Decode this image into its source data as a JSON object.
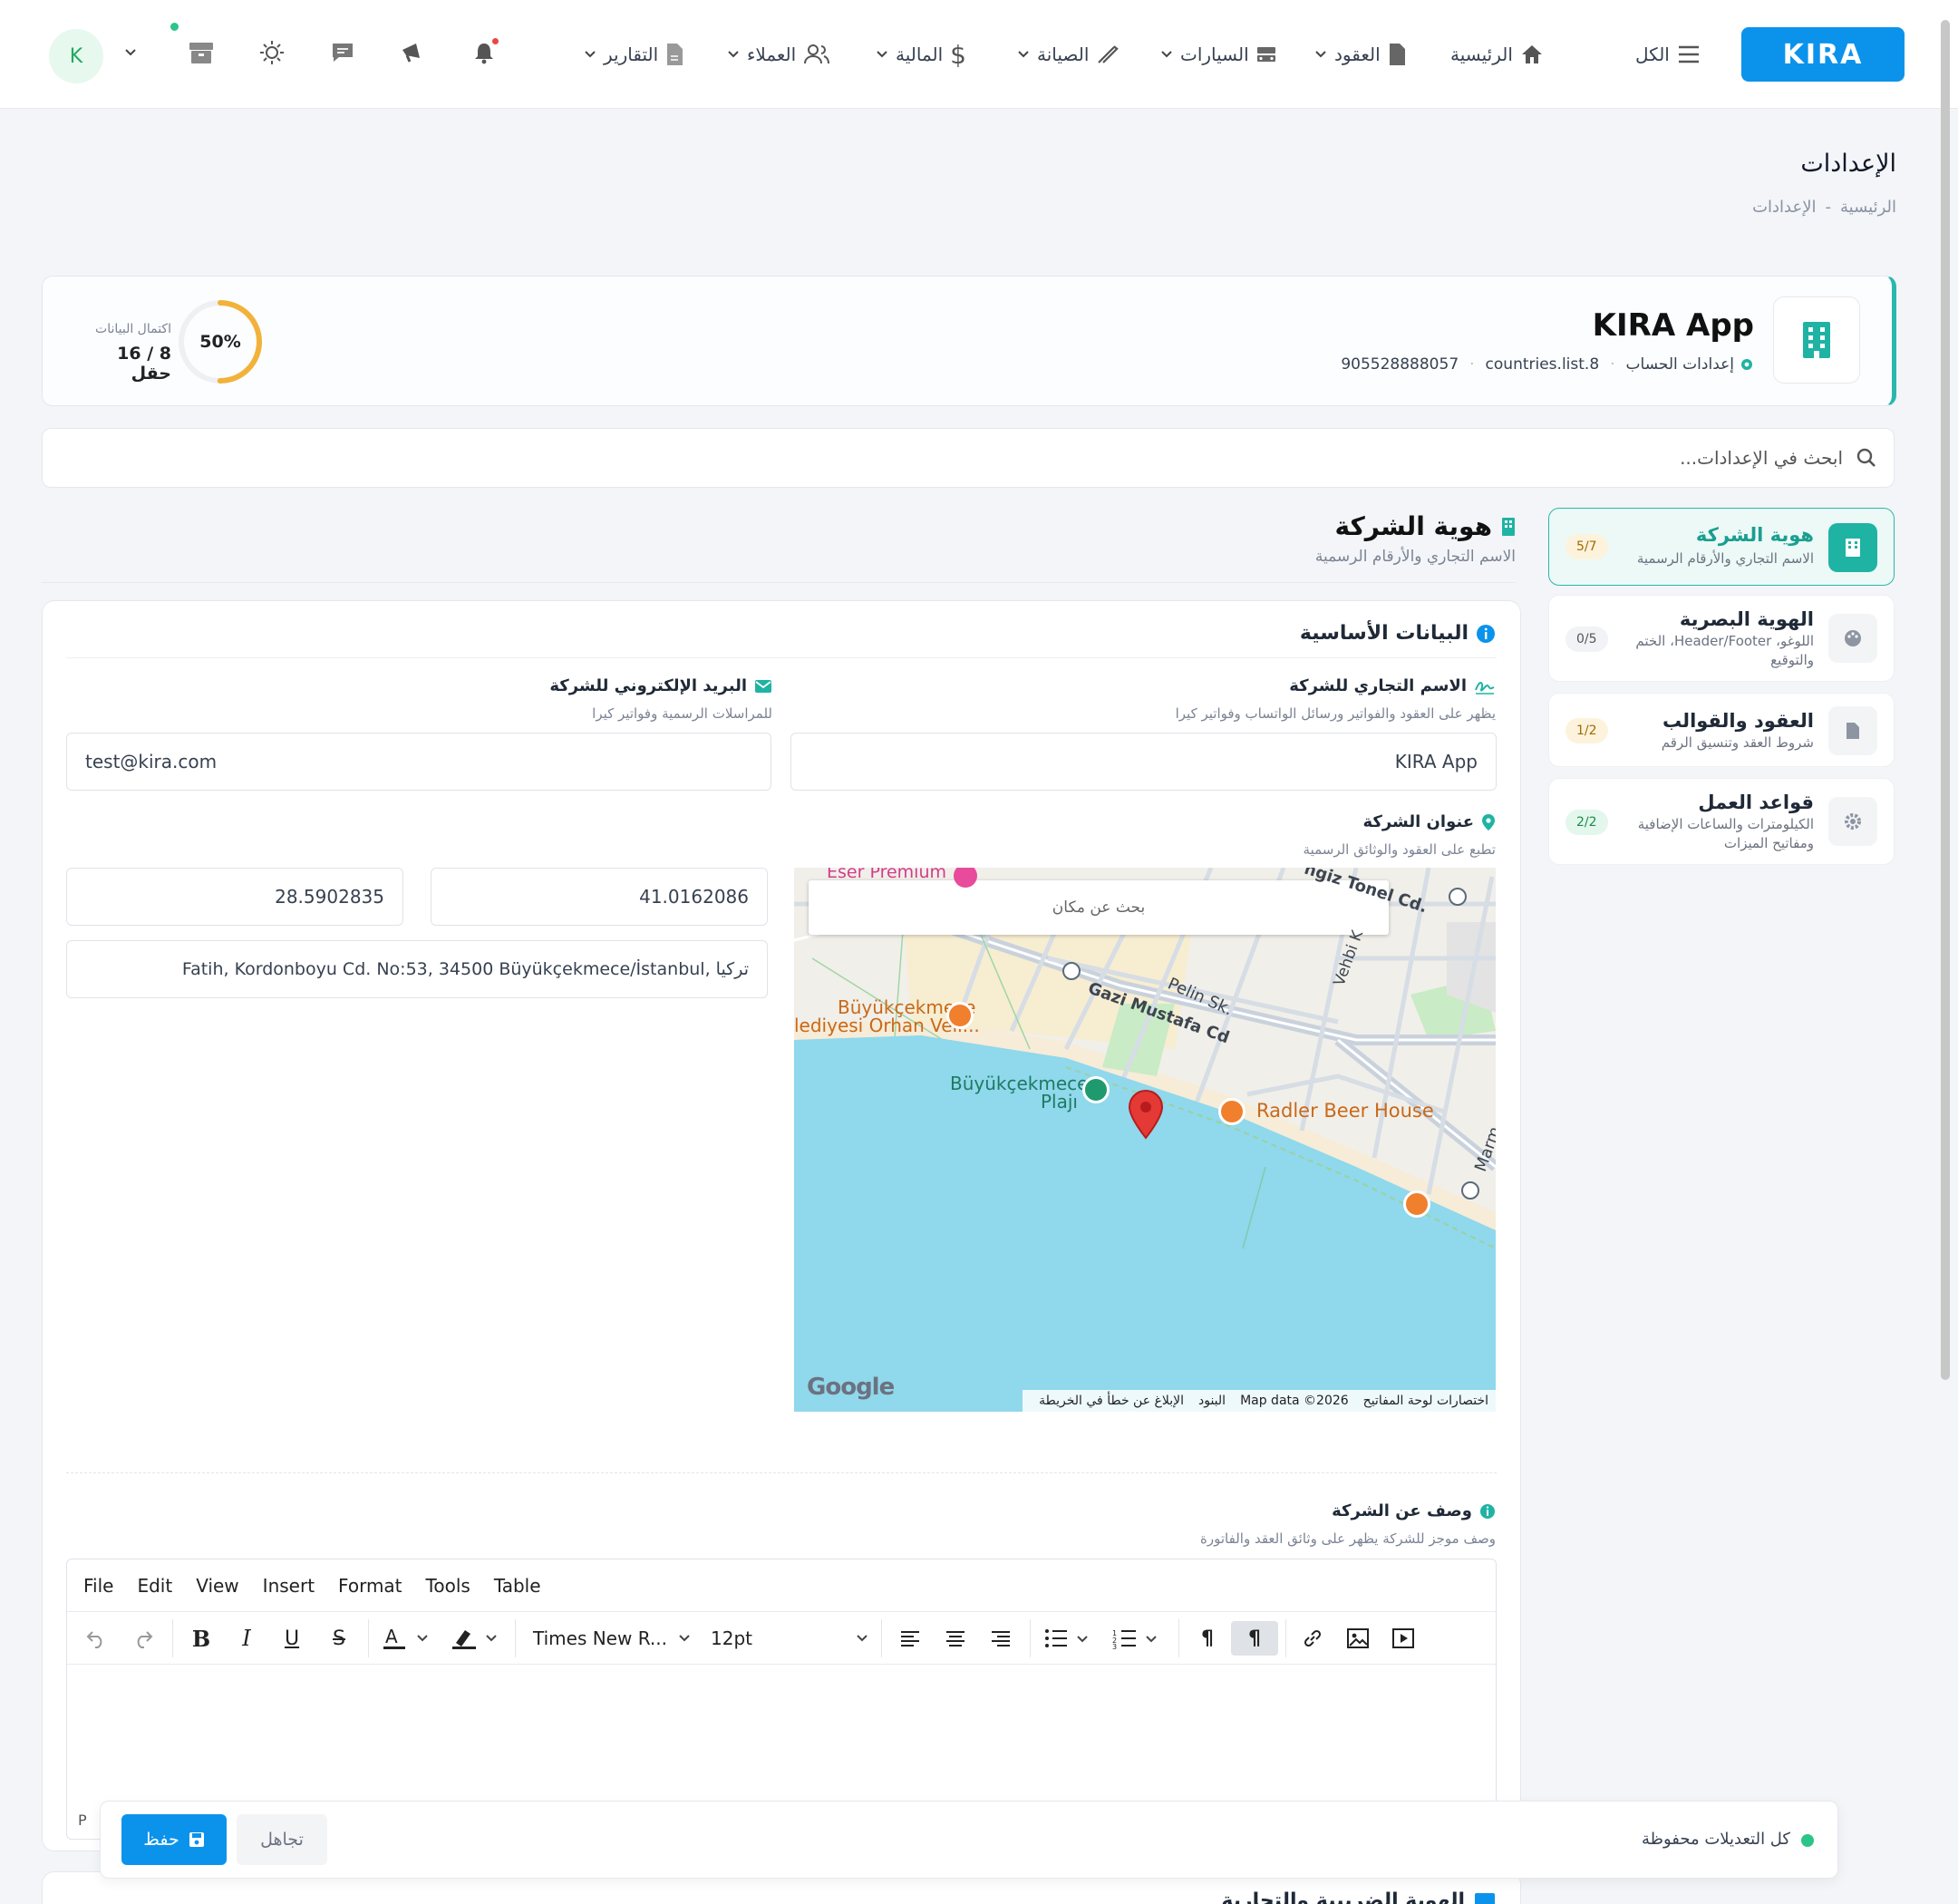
{
  "topbar": {
    "logo": "KIRA",
    "all_label": "الكل",
    "nav": [
      "الرئيسية",
      "العقود",
      "السيارات",
      "الصيانة",
      "المالية",
      "العملاء",
      "التقارير"
    ],
    "avatar_letter": "K"
  },
  "page": {
    "title": "الإعدادات",
    "breadcrumb": [
      "الرئيسية",
      "-",
      "الإعدادات"
    ]
  },
  "company": {
    "name": "KIRA App",
    "account_settings": "إعدادات الحساب",
    "country": "countries.list.8",
    "phone": "905528888057",
    "completion_label": "اكتمال البيانات",
    "completion_count": "8 / 16 حقل",
    "completion_percent": "50%",
    "completion_value": 0.5
  },
  "search": {
    "placeholder": "ابحث في الإعدادات..."
  },
  "sidebar": [
    {
      "title": "هوية الشركة",
      "subtitle": "الاسم التجاري والأرقام الرسمية",
      "badge": "5/7"
    },
    {
      "title": "الهوية البصرية",
      "subtitle": "اللوغو، Header/Footer، الختم والتوقيع",
      "badge": "0/5"
    },
    {
      "title": "العقود والقوالب",
      "subtitle": "شروط العقد وتنسيق الرقم",
      "badge": "1/2"
    },
    {
      "title": "قواعد العمل",
      "subtitle": "الكيلومترات والساعات الإضافية ومفاتيح الميزات",
      "badge": "2/2"
    }
  ],
  "section": {
    "title": "هوية الشركة",
    "subtitle": "الاسم التجاري والأرقام الرسمية",
    "basic_title": "البيانات الأساسية",
    "trade_name_label": "الاسم التجاري للشركة",
    "trade_name_hint": "يظهر على العقود والفواتير ورسائل الواتساب وفواتير كيرا",
    "trade_name_value": "KIRA App",
    "email_label": "البريد الإلكتروني للشركة",
    "email_hint": "للمراسلات الرسمية وفواتير كيرا",
    "email_value": "test@kira.com",
    "address_label": "عنوان الشركة",
    "address_hint": "تطبع على العقود والوثائق الرسمية",
    "latitude": "41.0162086",
    "longitude": "28.5902835",
    "address_value": "Fatih, Kordonboyu Cd. No:53, 34500 Büyükçekmece/İstanbul, تركيا",
    "description_label": "وصف عن الشركة",
    "description_hint": "وصف موجز للشركة يظهر على وثائق العقد والفاتورة"
  },
  "map": {
    "search_placeholder": "بحث عن مكان",
    "labels": [
      "Eser Premium",
      "Gazi Mustafa Cd",
      "Pelin Sk.",
      "Vehbi K",
      "ngiz Tonel Cd.",
      "Büyükçekmece",
      "lediyesi Orhan Veli...",
      "Büyükçekmece",
      "Plajı",
      "Radler Beer House",
      "Marm"
    ],
    "footer": [
      "اختصارات لوحة المفاتيح",
      "Map data ©2026",
      "البنود",
      "الإبلاغ عن خطأ في الخريطة"
    ],
    "google": "Google"
  },
  "editor": {
    "menu": [
      "File",
      "Edit",
      "View",
      "Insert",
      "Format",
      "Tools",
      "Table"
    ],
    "font": "Times New R...",
    "size": "12pt",
    "status": "P"
  },
  "savebar": {
    "status": "كل التعديلات محفوظة",
    "ignore": "تجاهل",
    "save": "حفظ"
  },
  "next_section_title": "الهوية الضريبية والتجارية",
  "colors": {
    "primary": "#0b93ec",
    "teal": "#2bb7ad",
    "amber": "#f2b23a",
    "success": "#2bc48a"
  }
}
